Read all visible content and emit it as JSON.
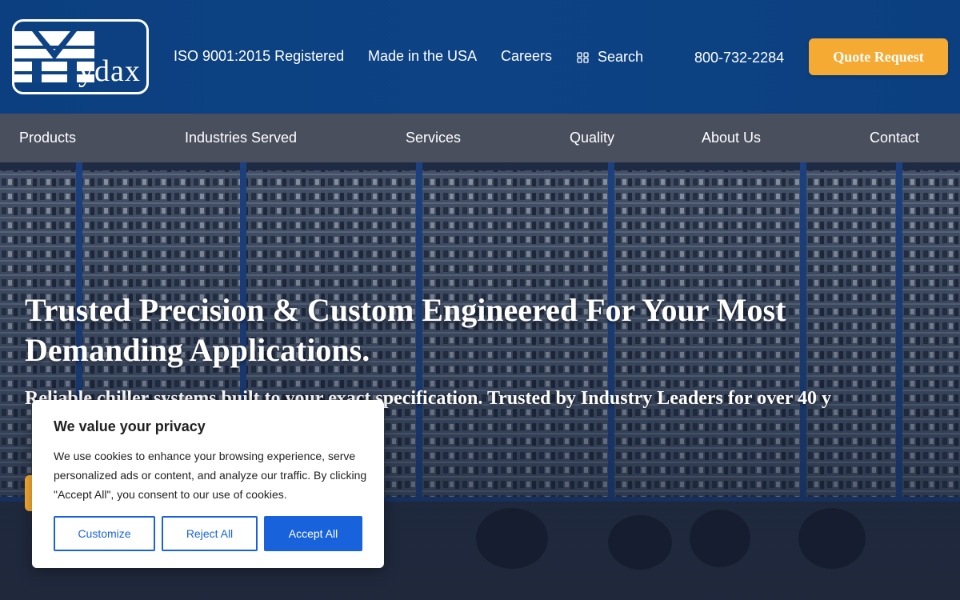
{
  "header": {
    "logo": {
      "text": "Mydax",
      "mark": "M"
    },
    "links": [
      {
        "label": "ISO 9001:2015 Registered"
      },
      {
        "label": "Made in the USA"
      },
      {
        "label": "Careers"
      }
    ],
    "search": {
      "label": "Search",
      "icon": "grid-search-icon"
    },
    "phone": "800-732-2284",
    "quote_button": "Quote Request"
  },
  "nav": {
    "items": [
      {
        "label": "Products"
      },
      {
        "label": "Industries Served"
      },
      {
        "label": "Services"
      },
      {
        "label": "Quality"
      },
      {
        "label": "About Us"
      },
      {
        "label": "Contact"
      }
    ]
  },
  "hero": {
    "title": "Trusted Precision & Custom Engineered For Your Most Demanding Applications.",
    "subtitle": "Reliable chiller systems built to your exact specification. Trusted by Industry Leaders for over 40 y"
  },
  "cookie_banner": {
    "title": "We value your privacy",
    "text": "We use cookies to enhance your browsing experience, serve personalized ads or content, and analyze our traffic. By clicking \"Accept All\", you consent to our use of cookies.",
    "customize": "Customize",
    "reject": "Reject All",
    "accept": "Accept All"
  },
  "colors": {
    "header_blue": "#0b3f80",
    "nav_gray": "#4a4f5e",
    "accent_orange": "#f5aa33",
    "cookie_blue": "#1863dc"
  }
}
